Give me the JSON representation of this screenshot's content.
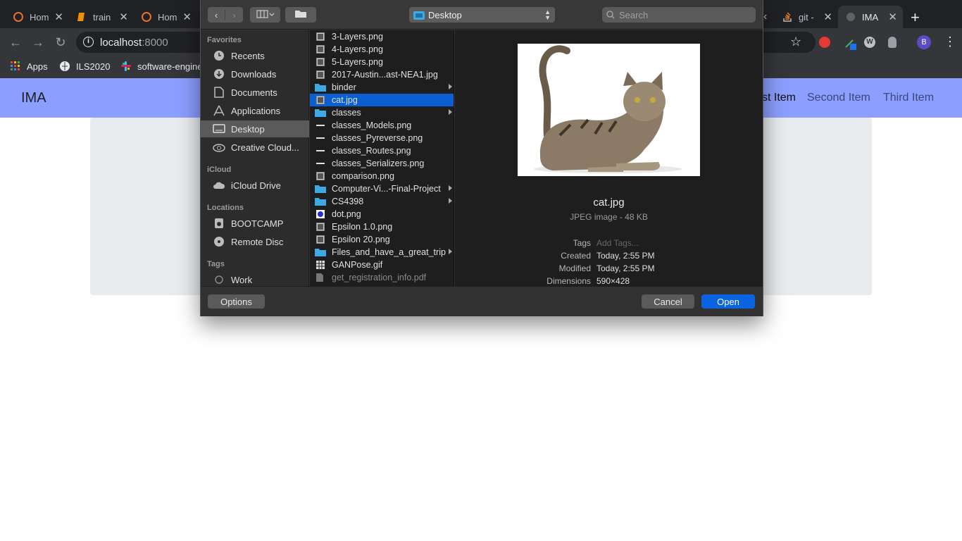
{
  "browser": {
    "tabs": [
      {
        "title": "Hom"
      },
      {
        "title": "train"
      },
      {
        "title": "Hom"
      },
      {
        "title": "git -"
      },
      {
        "title": "IMA"
      }
    ],
    "url_host": "localhost",
    "url_port": ":8000",
    "bookmarks": [
      {
        "label": "Apps"
      },
      {
        "label": "ILS2020"
      },
      {
        "label": "software-engine"
      }
    ],
    "profile_initial": "B"
  },
  "page": {
    "brand": "IMA",
    "nav": [
      {
        "label": "st Item",
        "active": true
      },
      {
        "label": "Second Item",
        "active": false
      },
      {
        "label": "Third Item",
        "active": false
      }
    ]
  },
  "dialog": {
    "location": "Desktop",
    "search_placeholder": "Search",
    "sidebar": {
      "favorites_header": "Favorites",
      "favorites": [
        {
          "label": "Recents",
          "icon": "clock-icon"
        },
        {
          "label": "Downloads",
          "icon": "download-icon"
        },
        {
          "label": "Documents",
          "icon": "document-icon"
        },
        {
          "label": "Applications",
          "icon": "applications-icon"
        },
        {
          "label": "Desktop",
          "icon": "desktop-icon",
          "selected": true
        },
        {
          "label": "Creative Cloud...",
          "icon": "creative-cloud-icon"
        }
      ],
      "icloud_header": "iCloud",
      "icloud": [
        {
          "label": "iCloud Drive",
          "icon": "cloud-icon"
        }
      ],
      "locations_header": "Locations",
      "locations": [
        {
          "label": "BOOTCAMP",
          "icon": "drive-icon"
        },
        {
          "label": "Remote Disc",
          "icon": "disc-icon"
        }
      ],
      "tags_header": "Tags",
      "tags": [
        {
          "label": "Work",
          "icon": "tag-dot-icon"
        }
      ]
    },
    "files": [
      {
        "name": "3-Layers.png",
        "kind": "image"
      },
      {
        "name": "4-Layers.png",
        "kind": "image"
      },
      {
        "name": "5-Layers.png",
        "kind": "image"
      },
      {
        "name": "2017-Austin...ast-NEA1.jpg",
        "kind": "image"
      },
      {
        "name": "binder",
        "kind": "folder"
      },
      {
        "name": "cat.jpg",
        "kind": "image",
        "selected": true
      },
      {
        "name": "classes",
        "kind": "folder"
      },
      {
        "name": "classes_Models.png",
        "kind": "line"
      },
      {
        "name": "classes_Pyreverse.png",
        "kind": "line"
      },
      {
        "name": "classes_Routes.png",
        "kind": "line"
      },
      {
        "name": "classes_Serializers.png",
        "kind": "line"
      },
      {
        "name": "comparison.png",
        "kind": "image"
      },
      {
        "name": "Computer-Vi...-Final-Project",
        "kind": "folder"
      },
      {
        "name": "CS4398",
        "kind": "folder"
      },
      {
        "name": "dot.png",
        "kind": "dot"
      },
      {
        "name": "Epsilon 1.0.png",
        "kind": "image"
      },
      {
        "name": "Epsilon 20.png",
        "kind": "image"
      },
      {
        "name": "Files_and_have_a_great_trip",
        "kind": "folder"
      },
      {
        "name": "GANPose.gif",
        "kind": "grid"
      },
      {
        "name": "get_registration_info.pdf",
        "kind": "pdf",
        "dim": true
      }
    ],
    "preview": {
      "name": "cat.jpg",
      "kind": "JPEG image - 48 KB",
      "tags_label": "Tags",
      "tags_placeholder": "Add Tags...",
      "created_label": "Created",
      "created": "Today, 2:55 PM",
      "modified_label": "Modified",
      "modified": "Today, 2:55 PM",
      "dimensions_label": "Dimensions",
      "dimensions": "590×428"
    },
    "options_label": "Options",
    "cancel_label": "Cancel",
    "open_label": "Open",
    "accent": "#0a5fd3",
    "folder_color": "#3fa9e6"
  }
}
